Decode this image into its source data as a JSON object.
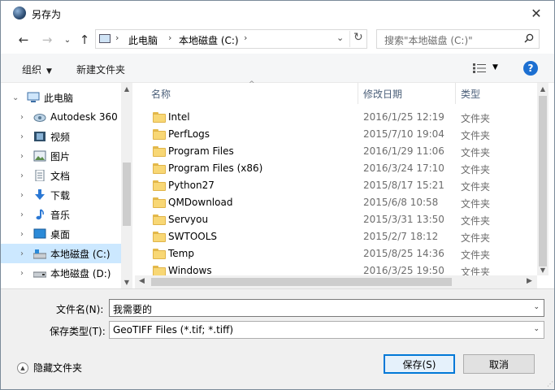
{
  "window": {
    "title": "另存为",
    "close": "✕"
  },
  "nav": {
    "back": "←",
    "forward": "→",
    "up": "↑",
    "breadcrumb": [
      "此电脑",
      "本地磁盘 (C:)"
    ],
    "search_placeholder": "搜索\"本地磁盘 (C:)\""
  },
  "toolbar": {
    "organize": "组织",
    "new_folder": "新建文件夹",
    "help": "?"
  },
  "tree": [
    {
      "label": "此电脑",
      "icon": "computer-icon",
      "expanded": true
    },
    {
      "label": "Autodesk 360",
      "icon": "cloud-icon"
    },
    {
      "label": "视频",
      "icon": "video-icon"
    },
    {
      "label": "图片",
      "icon": "picture-icon"
    },
    {
      "label": "文档",
      "icon": "document-icon"
    },
    {
      "label": "下载",
      "icon": "download-icon"
    },
    {
      "label": "音乐",
      "icon": "music-icon"
    },
    {
      "label": "桌面",
      "icon": "desktop-icon"
    },
    {
      "label": "本地磁盘 (C:)",
      "icon": "drive-icon",
      "selected": true
    },
    {
      "label": "本地磁盘 (D:)",
      "icon": "drive-icon"
    }
  ],
  "columns": {
    "name": "名称",
    "date": "修改日期",
    "type": "类型"
  },
  "files": [
    {
      "name": "Intel",
      "date": "2016/1/25 12:19",
      "type": "文件夹"
    },
    {
      "name": "PerfLogs",
      "date": "2015/7/10 19:04",
      "type": "文件夹"
    },
    {
      "name": "Program Files",
      "date": "2016/1/29 11:06",
      "type": "文件夹"
    },
    {
      "name": "Program Files (x86)",
      "date": "2016/3/24 17:10",
      "type": "文件夹"
    },
    {
      "name": "Python27",
      "date": "2015/8/17 15:21",
      "type": "文件夹"
    },
    {
      "name": "QMDownload",
      "date": "2015/6/8 10:58",
      "type": "文件夹"
    },
    {
      "name": "Servyou",
      "date": "2015/3/31 13:50",
      "type": "文件夹"
    },
    {
      "name": "SWTOOLS",
      "date": "2015/2/7 18:12",
      "type": "文件夹"
    },
    {
      "name": "Temp",
      "date": "2015/8/25 14:36",
      "type": "文件夹"
    },
    {
      "name": "Windows",
      "date": "2016/3/25 19:50",
      "type": "文件夹"
    }
  ],
  "form": {
    "filename_label": "文件名(N):",
    "filename_value": "我需要的",
    "filetype_label": "保存类型(T):",
    "filetype_value": "GeoTIFF Files (*.tif; *.tiff)"
  },
  "footer": {
    "hide_folders": "隐藏文件夹",
    "save": "保存(S)",
    "cancel": "取消"
  },
  "colors": {
    "accent": "#0078d7",
    "selected_bg": "#cce8ff",
    "folder": "#f8d775"
  }
}
